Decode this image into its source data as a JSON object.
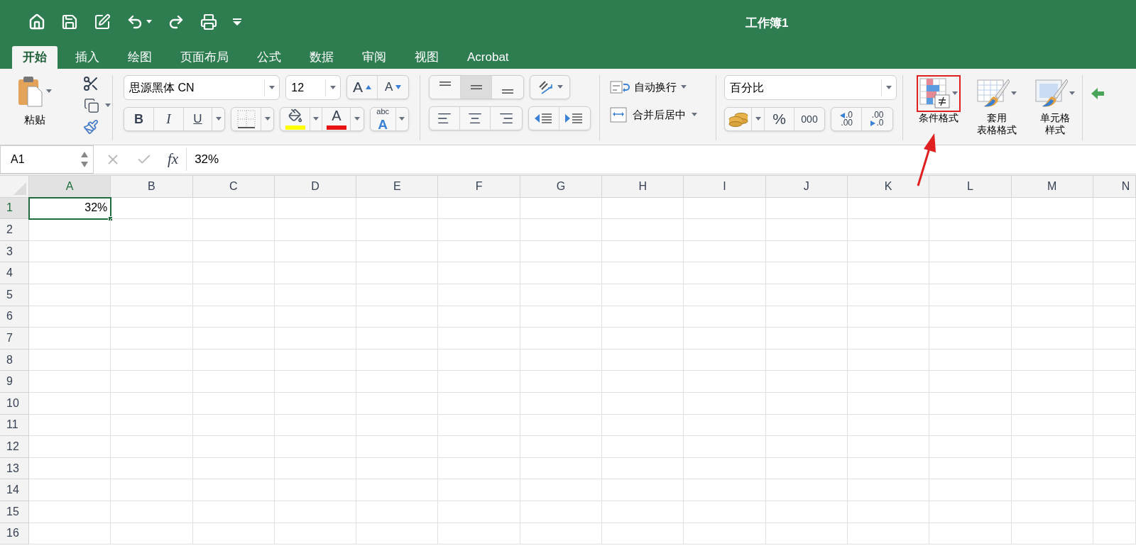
{
  "window": {
    "title": "工作簿1"
  },
  "tabs": [
    {
      "label": "开始",
      "selected": true
    },
    {
      "label": "插入",
      "selected": false
    },
    {
      "label": "绘图",
      "selected": false
    },
    {
      "label": "页面布局",
      "selected": false
    },
    {
      "label": "公式",
      "selected": false
    },
    {
      "label": "数据",
      "selected": false
    },
    {
      "label": "审阅",
      "selected": false
    },
    {
      "label": "视图",
      "selected": false
    },
    {
      "label": "Acrobat",
      "selected": false
    }
  ],
  "ribbon": {
    "paste": "粘贴",
    "font_name": "思源黑体 CN",
    "font_size": "12",
    "grow_font": "A",
    "shrink_font": "A",
    "bold": "B",
    "italic": "I",
    "underline": "U",
    "font_color": "A",
    "phonetic": [
      "abc",
      "A"
    ],
    "wrap_text": "自动换行",
    "merge_center": "合并后居中",
    "number_format": "百分比",
    "percent": "%",
    "comma": "000",
    "increase_decimal": [
      ".0",
      ".00"
    ],
    "decrease_decimal": [
      ".00",
      ".0"
    ],
    "styles": [
      {
        "lines": [
          "条件格式"
        ],
        "highlighted": true
      },
      {
        "lines": [
          "套用",
          "表格格式"
        ],
        "highlighted": false
      },
      {
        "lines": [
          "单元格",
          "样式"
        ],
        "highlighted": false
      }
    ]
  },
  "formula_bar": {
    "name_box": "A1",
    "fx": "fx",
    "formula": "32%"
  },
  "sheet": {
    "columns": [
      {
        "label": "A",
        "selected": true
      },
      {
        "label": "B",
        "selected": false
      },
      {
        "label": "C",
        "selected": false
      },
      {
        "label": "D",
        "selected": false
      },
      {
        "label": "E",
        "selected": false
      },
      {
        "label": "F",
        "selected": false
      },
      {
        "label": "G",
        "selected": false
      },
      {
        "label": "H",
        "selected": false
      },
      {
        "label": "I",
        "selected": false
      },
      {
        "label": "J",
        "selected": false
      },
      {
        "label": "K",
        "selected": false
      },
      {
        "label": "L",
        "selected": false
      },
      {
        "label": "M",
        "selected": false
      },
      {
        "label": "N",
        "selected": false
      }
    ],
    "rows": [
      {
        "label": "1",
        "selected": true,
        "cells": [
          "32%"
        ]
      },
      {
        "label": "2",
        "selected": false
      },
      {
        "label": "3",
        "selected": false
      },
      {
        "label": "4",
        "selected": false
      },
      {
        "label": "5",
        "selected": false
      },
      {
        "label": "6",
        "selected": false
      },
      {
        "label": "7",
        "selected": false
      },
      {
        "label": "8",
        "selected": false
      },
      {
        "label": "9",
        "selected": false
      },
      {
        "label": "10",
        "selected": false
      },
      {
        "label": "11",
        "selected": false
      },
      {
        "label": "12",
        "selected": false
      },
      {
        "label": "13",
        "selected": false
      },
      {
        "label": "14",
        "selected": false
      },
      {
        "label": "15",
        "selected": false
      },
      {
        "label": "16",
        "selected": false
      }
    ]
  }
}
